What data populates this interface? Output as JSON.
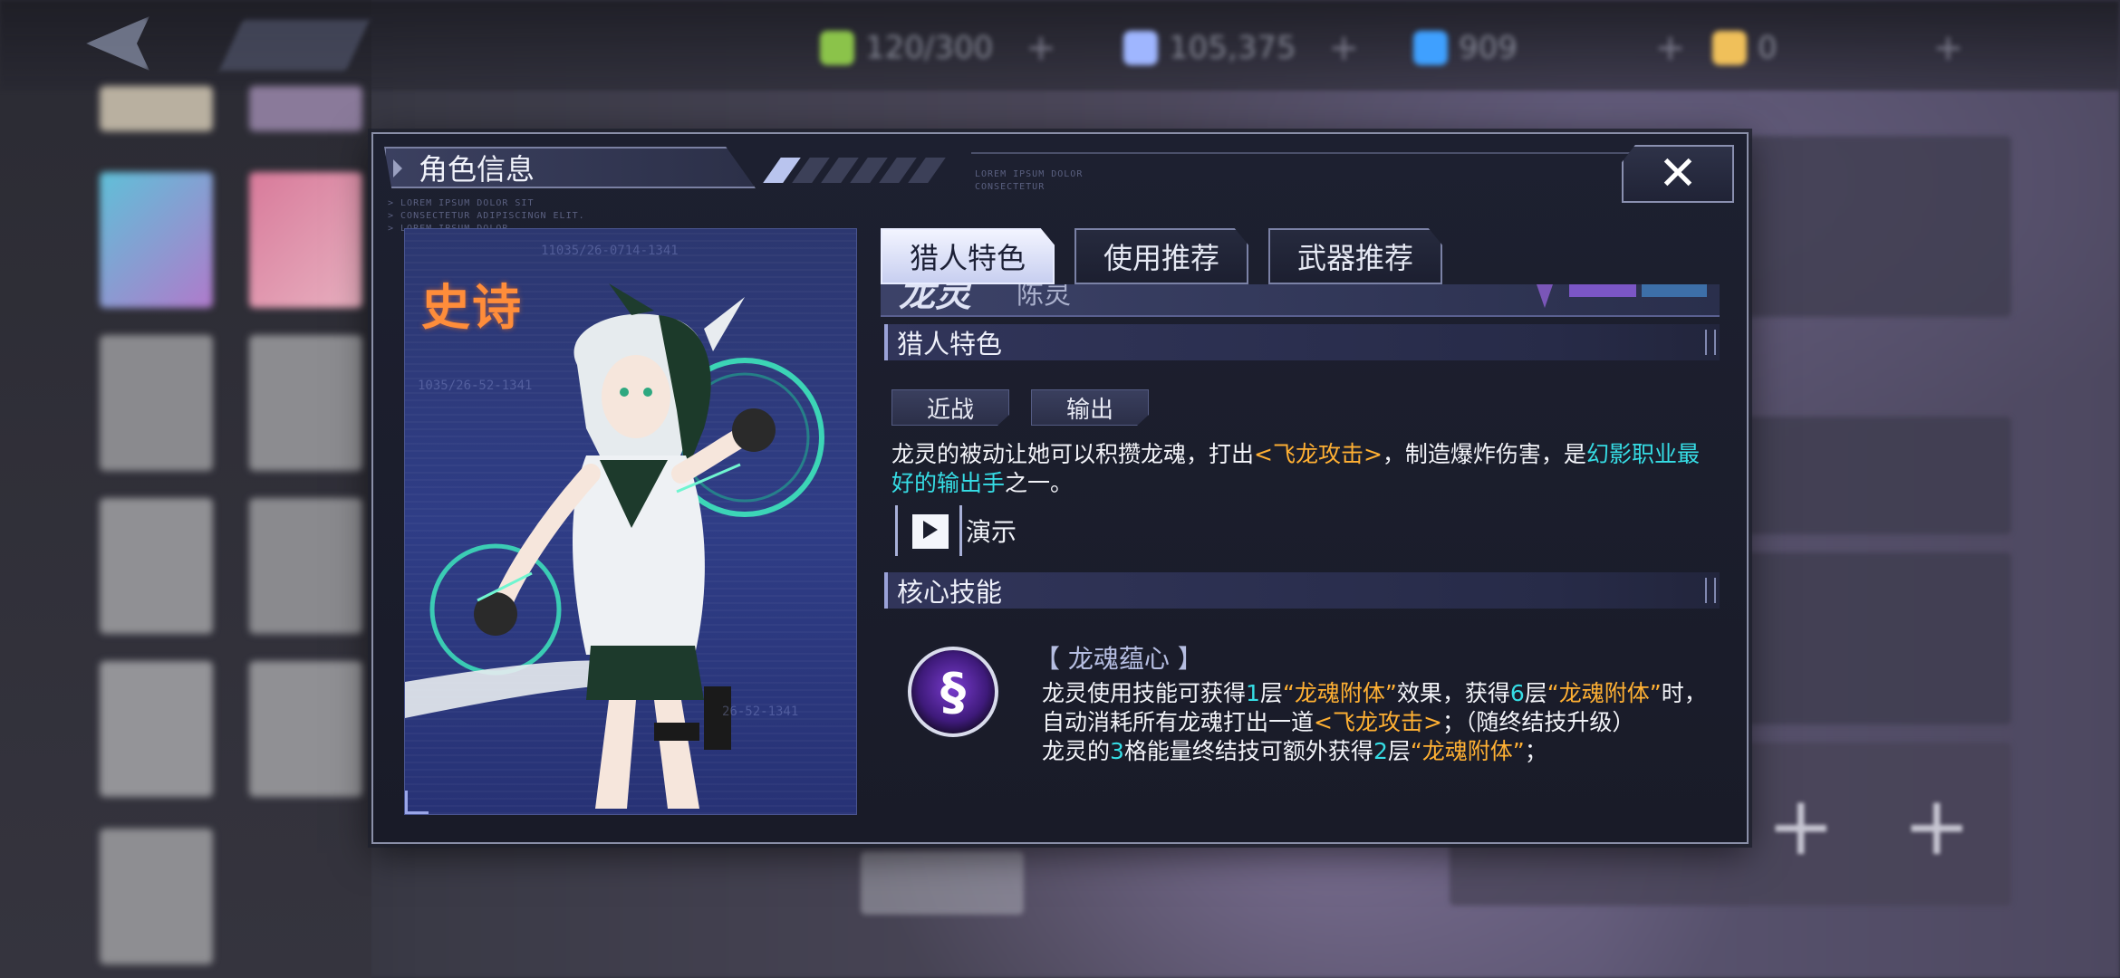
{
  "top_bar": {
    "resources": [
      {
        "name": "stamina",
        "value": "120/300",
        "icon": "energy-icon",
        "color": "#8bc34a"
      },
      {
        "name": "crystal",
        "value": "105,375",
        "icon": "gem-icon",
        "color": "#9fb6ff"
      },
      {
        "name": "ticket",
        "value": "909",
        "icon": "ticket-icon",
        "color": "#3fa0ff"
      },
      {
        "name": "coupon",
        "value": "0",
        "icon": "coupon-icon",
        "color": "#f0c05a"
      }
    ]
  },
  "dialog": {
    "title": "角色信息",
    "close_label": "✕",
    "lorem_top": [
      "LOREM IPSUM DOLOR",
      "CONSECTETUR"
    ],
    "lorem_left": [
      "> LOREM IPSUM DOLOR SIT",
      "> CONSECTETUR ADIPISCINGN ELIT.",
      "> LOREM IPSUM DOLOR"
    ]
  },
  "portrait": {
    "rarity": "史诗",
    "rarity_color": "#ff8d3a"
  },
  "tabs": [
    {
      "label": "猎人特色",
      "active": true
    },
    {
      "label": "使用推荐",
      "active": false
    },
    {
      "label": "武器推荐",
      "active": false
    }
  ],
  "character": {
    "name": "龙灵",
    "subtitle": "陈灵"
  },
  "hunter_traits": {
    "header": "猎人特色",
    "tags": [
      "近战",
      "输出"
    ],
    "desc_parts": {
      "p1": "龙灵的被动让她可以积攒龙魂，打出",
      "h1": "<飞龙攻击>",
      "p2": "，制造爆炸伤害，是",
      "h2": "幻影职业最好的输出手",
      "p3": "之一。"
    },
    "demo_label": "演示"
  },
  "core_skill": {
    "header": "核心技能",
    "name": "【 龙魂蕴心 】",
    "icon": "dragon-icon",
    "desc_parts": {
      "a1": "龙灵使用技能可获得",
      "n1": "1",
      "a2": "层",
      "h1": "“龙魂附体”",
      "a3": "效果，获得",
      "n2": "6",
      "a4": "层",
      "h2": "“龙魂附体”",
      "a5": "时，自动消耗所有龙魂打出一道",
      "h3": "<飞龙攻击>",
      "a6": "；（随终结技升级）",
      "b1": "龙灵的",
      "n3": "3",
      "b2": "格能量终结技可额外获得",
      "n4": "2",
      "b3": "层",
      "h4": "“龙魂附体”",
      "b4": "；"
    }
  },
  "colors": {
    "highlight_orange": "#ffb033",
    "highlight_cyan": "#36dde5",
    "dialog_bg": "#1d2030"
  }
}
